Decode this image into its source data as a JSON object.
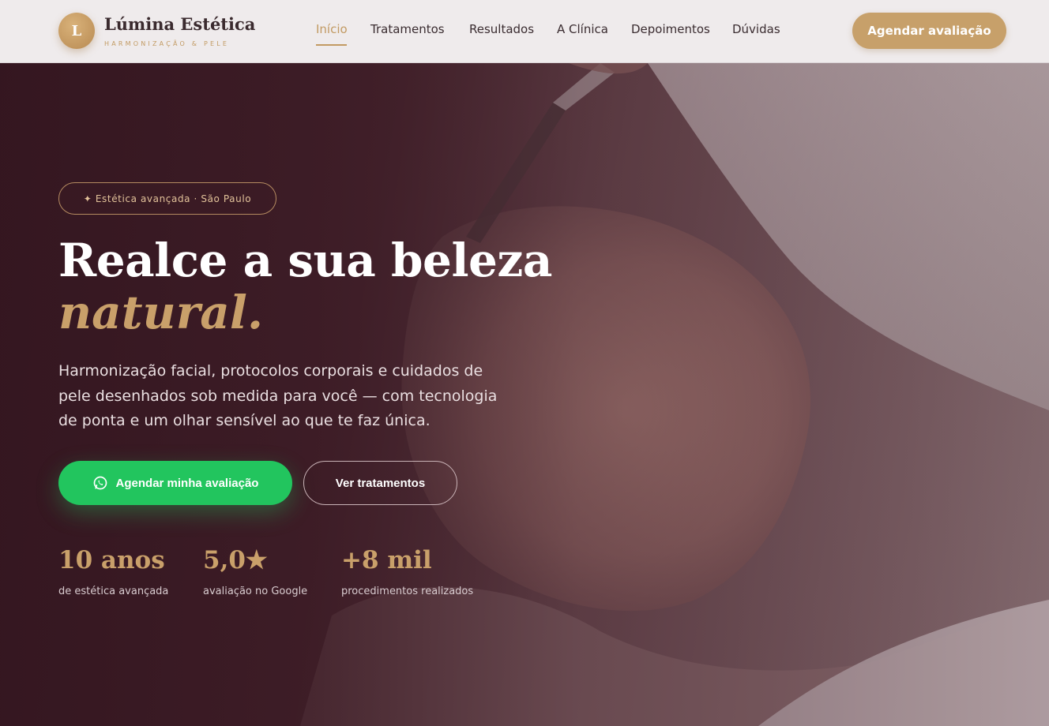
{
  "colors": {
    "accent_gold": "#c29a62",
    "cta_green": "#22c55e",
    "header_bg": "#efebec",
    "hero_bg": "#3b1c25"
  },
  "header": {
    "logo_letter": "L",
    "brand_name": "Lúmina Estética",
    "brand_tagline": "HARMONIZAÇÃO & PELE",
    "nav": [
      {
        "label": "Início",
        "active": true
      },
      {
        "label": "Tratamentos",
        "active": false
      },
      {
        "label": "Resultados",
        "active": false
      },
      {
        "label": "A Clínica",
        "active": false
      },
      {
        "label": "Depoimentos",
        "active": false
      },
      {
        "label": "Dúvidas",
        "active": false
      }
    ],
    "cta_label": "Agendar avaliação"
  },
  "hero": {
    "badge": "✦ Estética avançada · São Paulo",
    "headline_line1": "Realce a sua beleza",
    "headline_line2": "natural.",
    "subtitle": "Harmonização facial, protocolos corporais e cuidados de pele desenhados sob medida para você — com tecnologia de ponta e um olhar sensível ao que te faz única.",
    "primary_button": {
      "label": "Agendar minha avaliação",
      "icon": "whatsapp-icon"
    },
    "secondary_button": {
      "label": "Ver tratamentos"
    },
    "stats": [
      {
        "value": "10 anos",
        "label": "de estética avançada"
      },
      {
        "value": "5,0★",
        "label": "avaliação no Google"
      },
      {
        "value": "+8 mil",
        "label": "procedimentos realizados"
      }
    ]
  }
}
